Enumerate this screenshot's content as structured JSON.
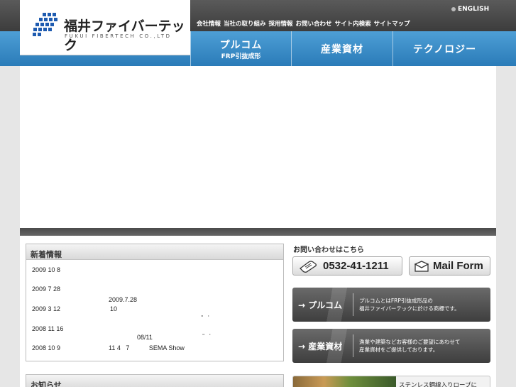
{
  "header": {
    "logo_name": "福井ファイバーテック",
    "logo_en": "FUKUI FIBERTECH CO.,LTD",
    "english_link": "ENGLISH",
    "top_nav": [
      "会社情報",
      "当社の取り組み",
      "採用情報",
      "お問い合わせ",
      "サイト内検索",
      "サイトマップ"
    ],
    "main_nav": [
      {
        "label": "プルコム",
        "sub": "FRP引抜成形"
      },
      {
        "label": "産業資材",
        "sub": ""
      },
      {
        "label": "テクノロジー",
        "sub": ""
      }
    ]
  },
  "news": {
    "title": "新着情報",
    "rows": [
      {
        "date": "2009 10 8",
        "text": ""
      },
      {
        "date": "2009 7 28",
        "text": ""
      },
      {
        "date": "2009 3 12",
        "text": "10"
      },
      {
        "date": "2008 11 16",
        "text": ""
      },
      {
        "date": "2008 10 9",
        "text": "11 4   7           SEMA Show"
      }
    ],
    "extras": [
      "2009.7.28",
      "08/11"
    ]
  },
  "notice": {
    "title": "お知らせ"
  },
  "contact": {
    "title": "お問い合わせはこちら",
    "phone": "0532-41-1211",
    "mail": "Mail Form"
  },
  "banners": [
    {
      "title": "プルコム",
      "desc_1": "プルコムとはFRP引抜成形品の",
      "desc_2": "福井ファイバーテックに於ける商標です。"
    },
    {
      "title": "産業資材",
      "desc_1": "漁業や建築などお客様のご要望にあわせて",
      "desc_2": "産業資材をご提供しております。"
    }
  ],
  "rope_banner": {
    "text": "ステンレス鋼線入りロープに"
  },
  "colors": {
    "topbar": "#3c3c3c",
    "bluebar": "#2a7bb8",
    "banner": "#3e3e3e"
  }
}
